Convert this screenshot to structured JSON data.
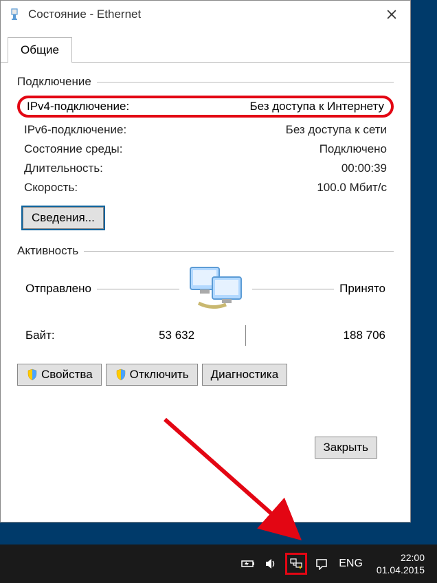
{
  "window": {
    "title": "Состояние - Ethernet",
    "tab": "Общие"
  },
  "connection": {
    "groupTitle": "Подключение",
    "rows": [
      {
        "label": "IPv4-подключение:",
        "value": "Без доступа к Интернету",
        "highlighted": true
      },
      {
        "label": "IPv6-подключение:",
        "value": "Без доступа к сети"
      },
      {
        "label": "Состояние среды:",
        "value": "Подключено"
      },
      {
        "label": "Длительность:",
        "value": "00:00:39"
      },
      {
        "label": "Скорость:",
        "value": "100.0 Мбит/с"
      }
    ],
    "detailsBtn": "Сведения..."
  },
  "activity": {
    "groupTitle": "Активность",
    "sentLabel": "Отправлено",
    "receivedLabel": "Принято",
    "bytesLabel": "Байт:",
    "bytesSent": "53 632",
    "bytesReceived": "188 706"
  },
  "buttons": {
    "properties": "Свойства",
    "disable": "Отключить",
    "diagnose": "Диагностика",
    "close": "Закрыть"
  },
  "taskbar": {
    "lang": "ENG",
    "time": "22:00",
    "date": "01.04.2015"
  }
}
